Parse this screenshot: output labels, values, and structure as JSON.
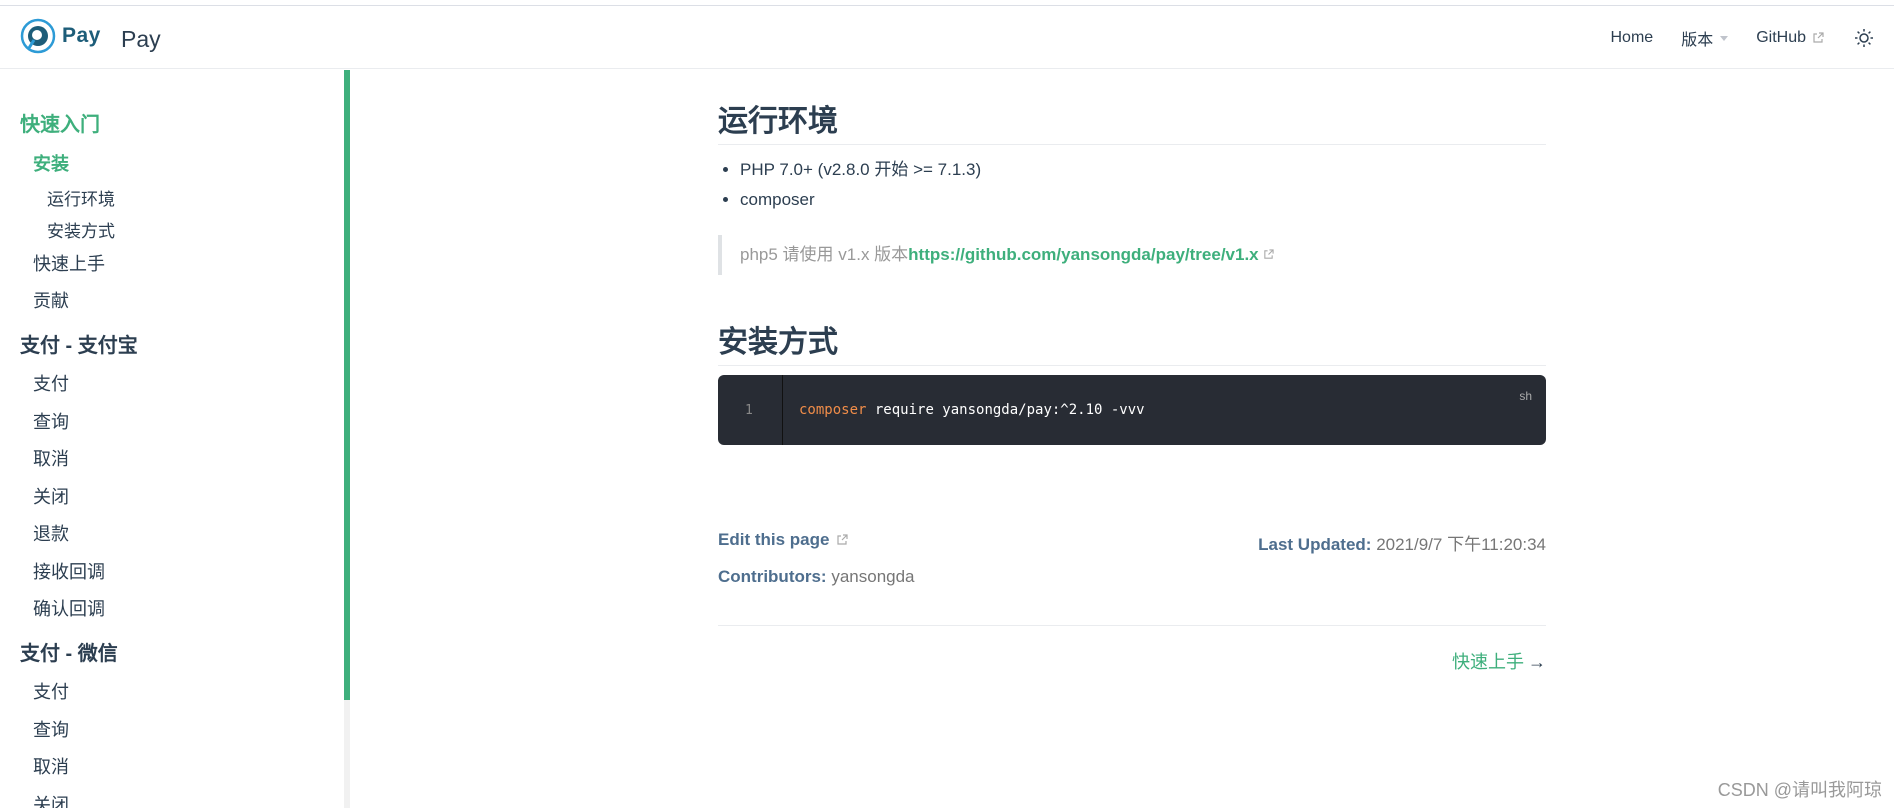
{
  "navbar": {
    "logo_text": "Pay",
    "site_title": "Pay",
    "links": [
      {
        "label": "Home"
      },
      {
        "label": "版本"
      },
      {
        "label": "GitHub"
      }
    ]
  },
  "sidebar": {
    "groups": [
      {
        "title": "快速入门"
      },
      {
        "title": "支付 - 支付宝"
      },
      {
        "title": "支付 - 微信"
      }
    ],
    "items": {
      "install": "安装",
      "env": "运行环境",
      "method": "安装方式",
      "quickstart": "快速上手",
      "contribute": "贡献",
      "ali_pay": "支付",
      "ali_query": "查询",
      "ali_cancel": "取消",
      "ali_close": "关闭",
      "ali_refund": "退款",
      "ali_notify": "接收回调",
      "ali_confirm": "确认回调",
      "wx_pay": "支付",
      "wx_query": "查询",
      "wx_cancel": "取消",
      "wx_close": "关闭"
    }
  },
  "content": {
    "section1_title": "运行环境",
    "bullets": [
      "PHP 7.0+ (v2.8.0 开始 >= 7.1.3)",
      "composer"
    ],
    "quote_text": "php5 请使用 v1.x 版本",
    "quote_link": "https://github.com/yansongda/pay/tree/v1.x",
    "section2_title": "安装方式",
    "code": {
      "line_number": "1",
      "command": "composer",
      "args": " require yansongda/pay:^2.10 -vvv",
      "lang": "sh"
    },
    "edit_link": "Edit this page",
    "last_updated_label": "Last Updated:",
    "last_updated_value": "2021/9/7 下午11:20:34",
    "contributors_label": "Contributors:",
    "contributors_value": "yansongda",
    "next_link": "快速上手",
    "next_arrow": "→"
  },
  "watermark": "CSDN @请叫我阿琼",
  "colors": {
    "accent": "#3eaf7c",
    "code_bg": "#282c34"
  }
}
